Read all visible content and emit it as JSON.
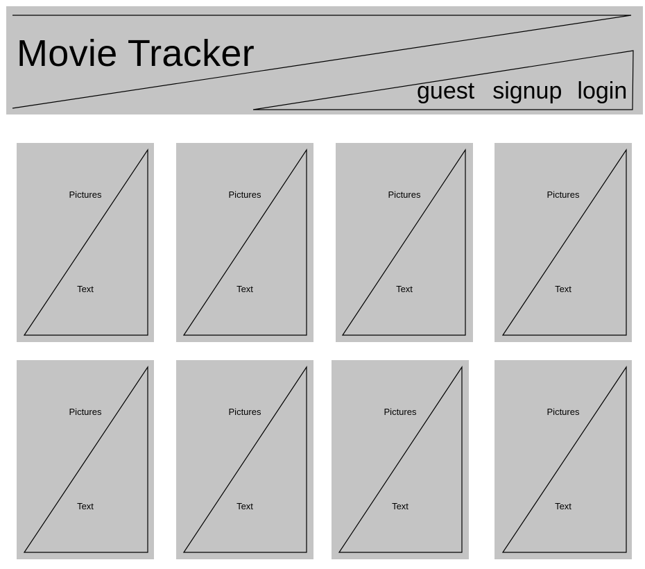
{
  "header": {
    "title": "Movie Tracker",
    "nav": {
      "guest": "guest",
      "signup": "signup",
      "login": "login"
    }
  },
  "cards": [
    {
      "image_label": "Pictures",
      "text_label": "Text"
    },
    {
      "image_label": "Pictures",
      "text_label": "Text"
    },
    {
      "image_label": "Pictures",
      "text_label": "Text"
    },
    {
      "image_label": "Pictures",
      "text_label": "Text"
    },
    {
      "image_label": "Pictures",
      "text_label": "Text"
    },
    {
      "image_label": "Pictures",
      "text_label": "Text"
    },
    {
      "image_label": "Pictures",
      "text_label": "Text"
    },
    {
      "image_label": "Pictures",
      "text_label": "Text"
    }
  ],
  "colors": {
    "placeholder_fill": "#c4c4c4",
    "stroke": "#000000",
    "background": "#ffffff"
  }
}
